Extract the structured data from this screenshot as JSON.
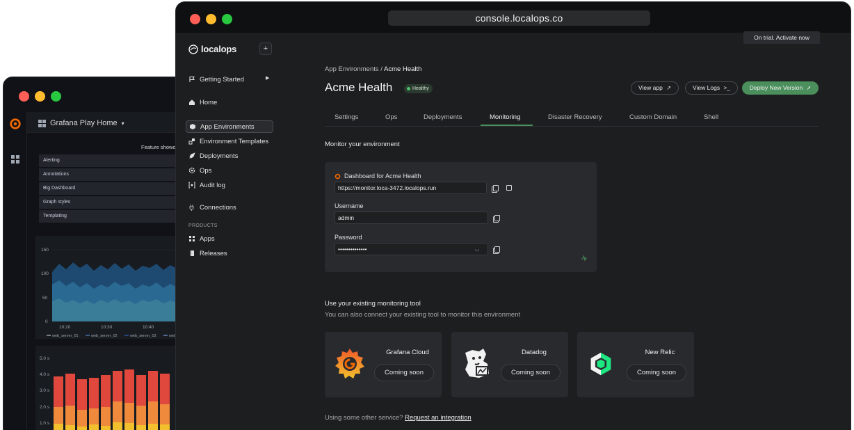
{
  "back_window": {
    "dashboard_title": "Grafana Play Home",
    "feature_heading": "Feature showca",
    "list_items": [
      "Alerting",
      "Annotations",
      "Big Dashboard",
      "Graph styles",
      "Templating"
    ],
    "chart_top": {
      "y_ticks": [
        "150",
        "100",
        "50",
        "0"
      ],
      "x_ticks": [
        "10:20",
        "10:30",
        "10:40"
      ],
      "legend": [
        "web_server_01",
        "web_server_02",
        "web_server_03",
        "web_"
      ]
    },
    "chart_bottom": {
      "y_ticks": [
        "5.0 s",
        "4.0 s",
        "3.0 s",
        "2.0 s",
        "1.0 s"
      ]
    }
  },
  "browser": {
    "url": "console.localops.co"
  },
  "sidebar": {
    "brand": "localops",
    "add_label": "+",
    "items": [
      {
        "label": "Getting Started",
        "icon": "flag-icon"
      },
      {
        "label": "Home",
        "icon": "home-icon"
      },
      {
        "label": "App Environments",
        "icon": "cube-icon"
      },
      {
        "label": "Environment Templates",
        "icon": "template-icon"
      },
      {
        "label": "Deployments",
        "icon": "rocket-icon"
      },
      {
        "label": "Ops",
        "icon": "gear-icon"
      },
      {
        "label": "Audit log",
        "icon": "audit-icon"
      },
      {
        "label": "Connections",
        "icon": "plug-icon"
      }
    ],
    "products_label": "PRODUCTS",
    "products": [
      {
        "label": "Apps",
        "icon": "apps-icon"
      },
      {
        "label": "Releases",
        "icon": "releases-icon"
      }
    ]
  },
  "trial_banner": "On trial. Activate now",
  "breadcrumb": {
    "parent": "App Environments",
    "separator": "/",
    "current": "Acme Health"
  },
  "header": {
    "title": "Acme Health",
    "status": "Healthy",
    "view_app": "View app",
    "view_logs": "View Logs",
    "deploy": "Deploy New Version"
  },
  "tabs": [
    "Settings",
    "Ops",
    "Deployments",
    "Monitoring",
    "Disaster Recovery",
    "Custom Domain",
    "Shell"
  ],
  "active_tab": "Monitoring",
  "monitor": {
    "heading": "Monitor your environment",
    "dashboard_title": "Dashboard for Acme Health",
    "dashboard_url": "https://monitor.loca-3472.localops.run",
    "username_label": "Username",
    "username_value": "admin",
    "password_label": "Password",
    "password_value": "••••••••••••••"
  },
  "existing": {
    "heading": "Use your existing monitoring tool",
    "subtitle": "You can also connect your existing tool to monitor this environment",
    "tools": [
      {
        "name": "Grafana Cloud",
        "status": "Coming soon"
      },
      {
        "name": "Datadog",
        "status": "Coming soon"
      },
      {
        "name": "New Relic",
        "status": "Coming soon"
      }
    ],
    "other_text": "Using some other service?",
    "other_link": "Request an integration"
  },
  "colors": {
    "accent_green": "#4a8f5c",
    "healthy_dot": "#4ec46b",
    "grafana_orange": "#f46800",
    "newrelic_green": "#1ce783"
  }
}
